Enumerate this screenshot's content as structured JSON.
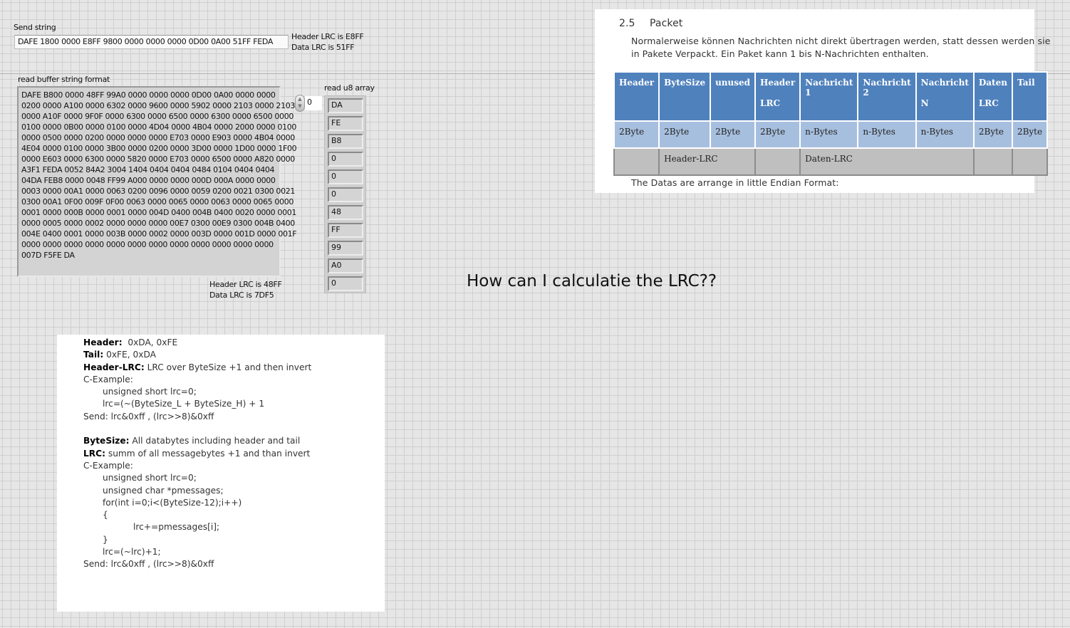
{
  "send": {
    "label": "Send string",
    "value": "DAFE 1800 0000 E8FF 9800 0000 0000 0000 0D00 0A00 51FF FEDA",
    "header_lrc": "Header LRC is E8FF",
    "data_lrc": "Data LRC is 51FF"
  },
  "read": {
    "label": "read buffer string format",
    "lines": [
      "DAFE B800 0000 48FF 99A0 0000 0000 0000 0D00 0A00 0000 0000",
      "0200 0000 A100 0000 6302 0000 9600 0000 5902 0000 2103 0000 2103",
      "0000 A10F 0000 9F0F 0000 6300 0000 6500 0000 6300 0000 6500 0000",
      "0100 0000 0B00 0000 0100 0000 4D04 0000 4B04 0000 2000 0000 0100",
      "0000 0500 0000 0200 0000 0000 0000 E703 0000 E903 0000 4B04 0000",
      "4E04 0000 0100 0000 3B00 0000 0200 0000 3D00 0000 1D00 0000 1F00",
      "0000 E603 0000 6300 0000 5820 0000 E703 0000 6500 0000 A820 0000",
      "A3F1 FEDA 0052 84A2 3004 1404 0404 0404 0484 0104 0404 0404",
      "04DA FEB8 0000 0048 FF99 A000 0000 0000 000D 000A 0000 0000",
      "0003 0000 00A1 0000 0063 0200 0096 0000 0059 0200 0021 0300 0021",
      "0300 00A1 0F00 009F 0F00 0063 0000 0065 0000 0063 0000 0065 0000",
      "0001 0000 000B 0000 0001 0000 004D 0400 004B 0400 0020 0000 0001",
      "0000 0005 0000 0002 0000 0000 0000 00E7 0300 00E9 0300 004B 0400",
      "004E 0400 0001 0000 003B 0000 0002 0000 003D 0000 001D 0000 001F",
      "0000 0000 0000 0000 0000 0000 0000 0000 0000 0000 0000 0000",
      "007D F5FE DA"
    ],
    "header_lrc": "Header LRC is 48FF",
    "data_lrc": "Data LRC is 7DF5"
  },
  "u8array": {
    "label": "read u8 array",
    "index": "0",
    "values": [
      "DA",
      "FE",
      "B8",
      "0",
      "0",
      "0",
      "48",
      "FF",
      "99",
      "A0",
      "0"
    ]
  },
  "doc": {
    "section_num": "2.5",
    "section_title": "Packet",
    "para1": "Normalerweise können Nachrichten nicht direkt übertragen werden, statt dessen werden sie",
    "para2": "in Pakete Verpackt. Ein Paket kann 1 bis N-Nachrichten enthalten.",
    "table_header": [
      [
        "Header",
        ""
      ],
      [
        "ByteSize",
        ""
      ],
      [
        "unused",
        ""
      ],
      [
        "Header",
        "LRC"
      ],
      [
        "Nachricht 1",
        ""
      ],
      [
        "Nachricht 2",
        ""
      ],
      [
        "Nachricht",
        "N"
      ],
      [
        "Daten",
        "LRC"
      ],
      [
        "Tail",
        ""
      ]
    ],
    "table_sizes": [
      "2Byte",
      "2Byte",
      "2Byte",
      "2Byte",
      "n-Bytes",
      "n-Bytes",
      "n-Bytes",
      "2Byte",
      "2Byte"
    ],
    "table_lrc": [
      "Header-LRC",
      "Daten-LRC"
    ],
    "footer": "The Datas are arrange in little Endian Format:"
  },
  "question": "How can I calculatie the LRC??",
  "notes": {
    "header_k": "Header:",
    "header_v": "  0xDA, 0xFE",
    "tail_k": "Tail:",
    "tail_v": " 0xFE, 0xDA",
    "hlrc_k": "Header-LRC:",
    "hlrc_v": " LRC over ByteSize +1 and then invert",
    "cex1": "C-Example:",
    "c1": "unsigned short lrc=0;",
    "c2": "lrc=(~(ByteSize_L + ByteSize_H) + 1",
    "send1": "Send: lrc&0xff , (lrc>>8)&0xff",
    "bs_k": "ByteSize:",
    "bs_v": " All databytes including header and tail",
    "lrc_k": "LRC:",
    "lrc_v": " summ of all messagebytes +1 and than invert",
    "cex2": "C-Example:",
    "d1": "unsigned short lrc=0;",
    "d2": "unsigned char *pmessages;",
    "d3": "for(int i=0;i<(ByteSize-12);i++)",
    "d4": "{",
    "d5": "lrc+=pmessages[i];",
    "d6": "}",
    "d7": "lrc=(~lrc)+1;",
    "send2": "Send: lrc&0xff , (lrc>>8)&0xff"
  }
}
